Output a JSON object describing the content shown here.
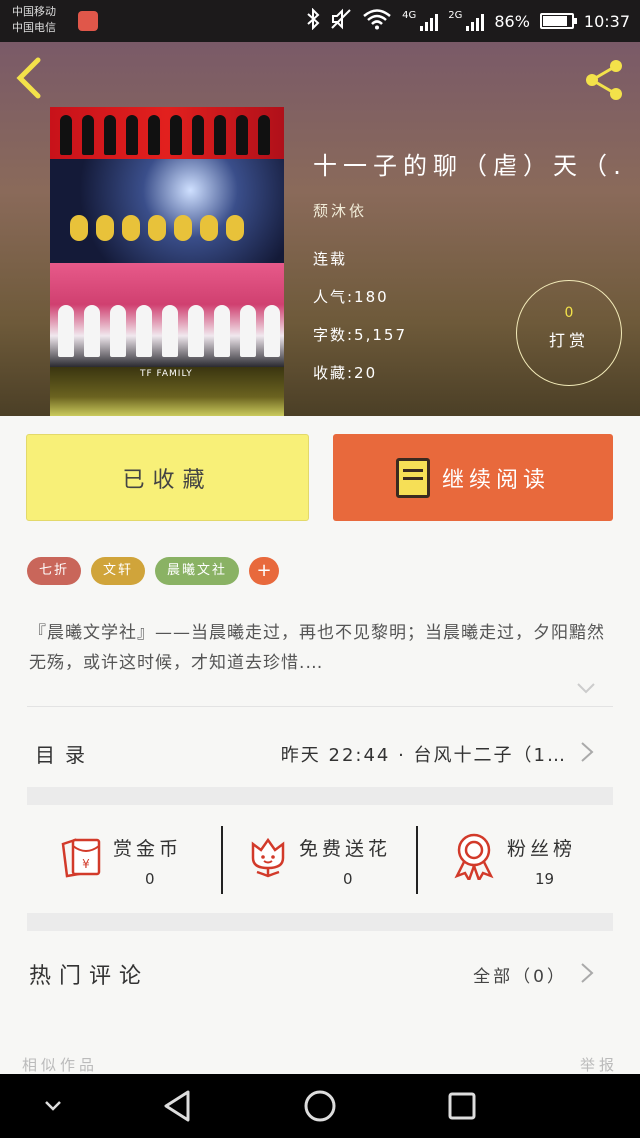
{
  "status_bar": {
    "carrier_1": "中国移动",
    "carrier_2": "中国电信",
    "network_1": "4G",
    "network_2": "2G",
    "battery_percent": "86%",
    "battery_level": 0.86,
    "time": "10:37"
  },
  "book": {
    "title": "十一子的聊（虐）天（…",
    "author": "颓沐依",
    "status": "连载",
    "popularity": "人气:180",
    "word_count": "字数:5,157",
    "favorites": "收藏:20",
    "reward_count": "0",
    "reward_label": "打赏",
    "cover_caption": "TF FAMILY"
  },
  "actions": {
    "collected_label": "已收藏",
    "read_label": "继续阅读"
  },
  "tags": [
    {
      "label": "七折",
      "color": "#c9665a"
    },
    {
      "label": "文轩",
      "color": "#d0a43a"
    },
    {
      "label": "晨曦文社",
      "color": "#8ab264"
    }
  ],
  "tag_add_label": "+",
  "intro": "『晨曦文学社』——当晨曦走过，再也不见黎明；当晨曦走过，夕阳黯然无殇，或许这时候，才知道去珍惜.…",
  "catalog": {
    "label": "目录",
    "latest": "昨天 22:44 · 台风十二子（1…"
  },
  "stats": [
    {
      "label": "赏金币",
      "value": "0",
      "icon": "red-envelope-icon"
    },
    {
      "label": "免费送花",
      "value": "0",
      "icon": "flower-icon"
    },
    {
      "label": "粉丝榜",
      "value": "19",
      "icon": "medal-icon"
    }
  ],
  "comments": {
    "label": "热门评论",
    "all_label": "全部（0）"
  },
  "footer": {
    "similar": "相似作品",
    "report": "举报"
  },
  "colors": {
    "accent_orange": "#e8693c",
    "collected_yellow": "#f8f078",
    "icon_red": "#d23a2a"
  }
}
